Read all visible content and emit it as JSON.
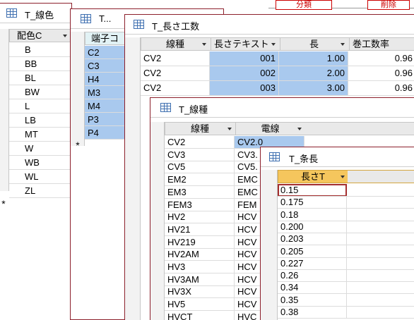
{
  "win_color": {
    "title": "T_線色",
    "header": "配色C",
    "rows": [
      "B",
      "BB",
      "BL",
      "BW",
      "L",
      "LB",
      "MT",
      "W",
      "WB",
      "WL",
      "ZL"
    ],
    "new_row": "*"
  },
  "win_terminal": {
    "title": "T...",
    "header": "端子コ",
    "rows": [
      "C2",
      "C3",
      "H4",
      "M3",
      "M4",
      "P3",
      "P4"
    ],
    "new_row": "*"
  },
  "win_length": {
    "title": "T_長さ工数",
    "headers": [
      "線種",
      "長さテキスト",
      "長",
      "巻工数率"
    ],
    "rows": [
      [
        "CV2",
        "001",
        "1.00",
        "0.96"
      ],
      [
        "CV2",
        "002",
        "2.00",
        "0.96"
      ],
      [
        "CV2",
        "003",
        "3.00",
        "0.96"
      ]
    ]
  },
  "win_wiretype": {
    "title": "T_線種",
    "headers": [
      "線種",
      "電線"
    ],
    "rows": [
      [
        "CV2",
        "CV2.0"
      ],
      [
        "CV3",
        "CV3."
      ],
      [
        "CV5",
        "CV5."
      ],
      [
        "EM2",
        "EMC"
      ],
      [
        "EM3",
        "EMC"
      ],
      [
        "FEM3",
        "FEM"
      ],
      [
        "HV2",
        "HCV"
      ],
      [
        "HV21",
        "HCV"
      ],
      [
        "HV219",
        "HCV"
      ],
      [
        "HV2AM",
        "HCV"
      ],
      [
        "HV3",
        "HCV"
      ],
      [
        "HV3AM",
        "HCV"
      ],
      [
        "HV3X",
        "HCV"
      ],
      [
        "HV5",
        "HCV"
      ],
      [
        "HVCT",
        "HVC"
      ]
    ],
    "left_col_char": "C"
  },
  "win_jocho": {
    "title": "T_条長",
    "header": "長さT",
    "rows": [
      "0.15",
      "0.175",
      "0.18",
      "0.200",
      "0.203",
      "0.205",
      "0.227",
      "0.26",
      "0.34",
      "0.35",
      "0.38"
    ]
  },
  "bg_fragments": {
    "button_a": "分類",
    "button_b": "削除"
  },
  "colors": {
    "selection": "#a9c9ee",
    "window_border": "#8c1f2b",
    "active_header": "#f5c65d"
  }
}
